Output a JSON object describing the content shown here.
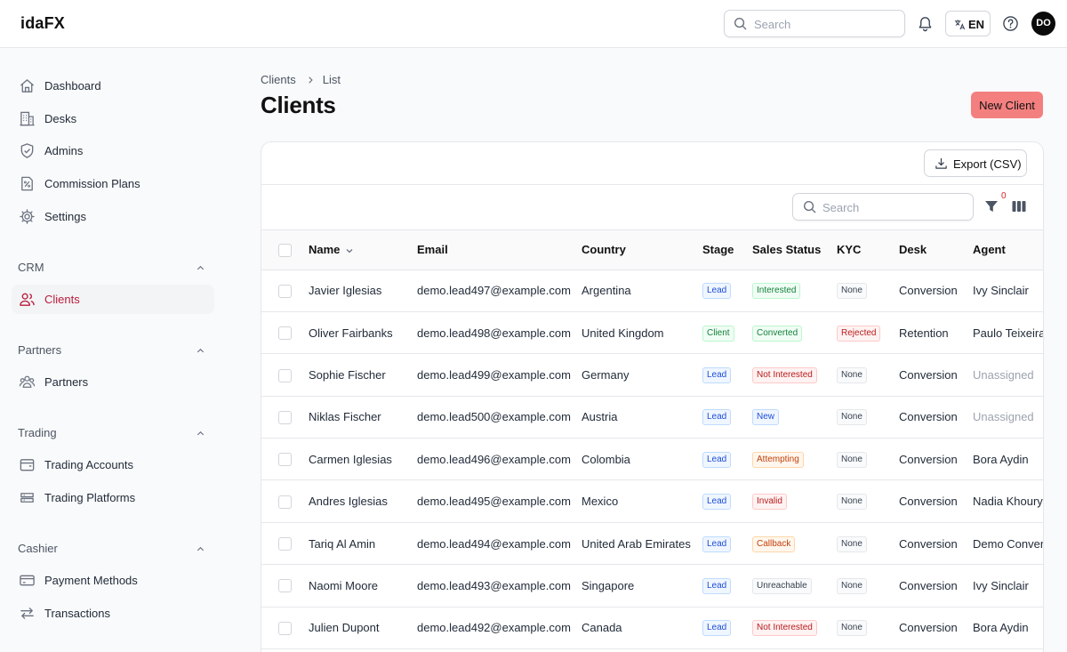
{
  "app": {
    "brand": "idaFX"
  },
  "topbar": {
    "search_placeholder": "Search",
    "language": "EN",
    "avatar_initials": "DO"
  },
  "sidebar": {
    "main_items": [
      {
        "label": "Dashboard",
        "icon": "home-icon"
      },
      {
        "label": "Desks",
        "icon": "building-icon"
      },
      {
        "label": "Admins",
        "icon": "shield-icon"
      },
      {
        "label": "Commission Plans",
        "icon": "document-percent-icon"
      },
      {
        "label": "Settings",
        "icon": "gear-icon"
      }
    ],
    "groups": [
      {
        "label": "CRM",
        "items": [
          {
            "label": "Clients",
            "icon": "users-icon",
            "active": true
          }
        ]
      },
      {
        "label": "Partners",
        "items": [
          {
            "label": "Partners",
            "icon": "user-group-icon"
          }
        ]
      },
      {
        "label": "Trading",
        "items": [
          {
            "label": "Trading Accounts",
            "icon": "wallet-icon"
          },
          {
            "label": "Trading Platforms",
            "icon": "server-icon"
          }
        ]
      },
      {
        "label": "Cashier",
        "items": [
          {
            "label": "Payment Methods",
            "icon": "credit-card-icon"
          },
          {
            "label": "Transactions",
            "icon": "arrows-exchange-icon"
          }
        ]
      }
    ]
  },
  "page": {
    "breadcrumb": [
      "Clients",
      "List"
    ],
    "title": "Clients",
    "new_button": "New Client",
    "accent_color": "#f47f7f"
  },
  "table": {
    "export_label": "Export (CSV)",
    "search_placeholder": "Search",
    "filter_count": "0",
    "columns": [
      "Name",
      "Email",
      "Country",
      "Stage",
      "Sales Status",
      "KYC",
      "Desk",
      "Agent"
    ],
    "rows": [
      {
        "name": "Javier Iglesias",
        "email": "demo.lead497@example.com",
        "country": "Argentina",
        "stage": "Lead",
        "sales_status": "Interested",
        "kyc": "None",
        "desk": "Conversion",
        "agent": "Ivy Sinclair"
      },
      {
        "name": "Oliver Fairbanks",
        "email": "demo.lead498@example.com",
        "country": "United Kingdom",
        "stage": "Client",
        "sales_status": "Converted",
        "kyc": "Rejected",
        "desk": "Retention",
        "agent": "Paulo Teixeira"
      },
      {
        "name": "Sophie Fischer",
        "email": "demo.lead499@example.com",
        "country": "Germany",
        "stage": "Lead",
        "sales_status": "Not Interested",
        "kyc": "None",
        "desk": "Conversion",
        "agent": "Unassigned"
      },
      {
        "name": "Niklas Fischer",
        "email": "demo.lead500@example.com",
        "country": "Austria",
        "stage": "Lead",
        "sales_status": "New",
        "kyc": "None",
        "desk": "Conversion",
        "agent": "Unassigned"
      },
      {
        "name": "Carmen Iglesias",
        "email": "demo.lead496@example.com",
        "country": "Colombia",
        "stage": "Lead",
        "sales_status": "Attempting",
        "kyc": "None",
        "desk": "Conversion",
        "agent": "Bora Aydin"
      },
      {
        "name": "Andres Iglesias",
        "email": "demo.lead495@example.com",
        "country": "Mexico",
        "stage": "Lead",
        "sales_status": "Invalid",
        "kyc": "None",
        "desk": "Conversion",
        "agent": "Nadia Khoury"
      },
      {
        "name": "Tariq Al Amin",
        "email": "demo.lead494@example.com",
        "country": "United Arab Emirates",
        "stage": "Lead",
        "sales_status": "Callback",
        "kyc": "None",
        "desk": "Conversion",
        "agent": "Demo Convers"
      },
      {
        "name": "Naomi Moore",
        "email": "demo.lead493@example.com",
        "country": "Singapore",
        "stage": "Lead",
        "sales_status": "Unreachable",
        "kyc": "None",
        "desk": "Conversion",
        "agent": "Ivy Sinclair"
      },
      {
        "name": "Julien Dupont",
        "email": "demo.lead492@example.com",
        "country": "Canada",
        "stage": "Lead",
        "sales_status": "Not Interested",
        "kyc": "None",
        "desk": "Conversion",
        "agent": "Bora Aydin"
      }
    ]
  }
}
